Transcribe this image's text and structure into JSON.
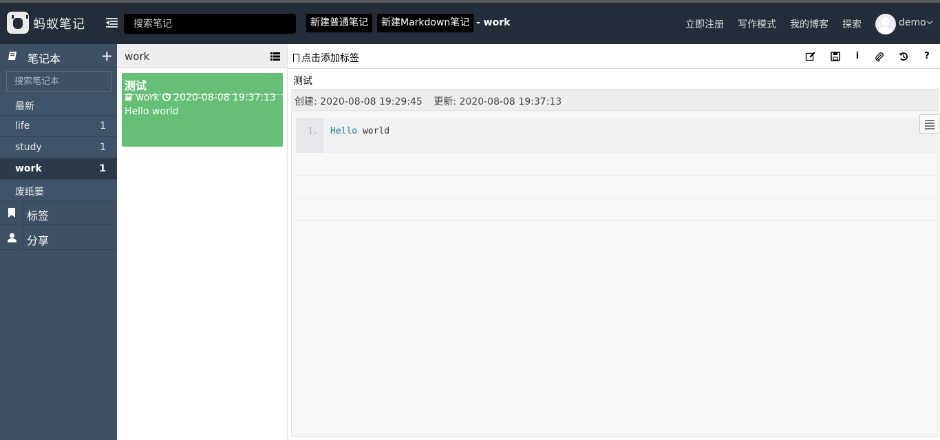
{
  "header": {
    "logo_text": "蚂蚁笔记",
    "search_placeholder": "搜索笔记",
    "new_note_label": "新建普通笔记",
    "new_markdown_label": "新建Markdown笔记",
    "current_notebook": "- work",
    "nav": [
      "立即注册",
      "写作模式",
      "我的博客",
      "探索"
    ],
    "username": "demo"
  },
  "sidebar": {
    "notebook_header": "笔记本",
    "add_symbol": "+",
    "notebook_search_placeholder": "搜索笔记本",
    "notebooks": [
      {
        "name": "最新",
        "count": ""
      },
      {
        "name": "life",
        "count": "1"
      },
      {
        "name": "study",
        "count": "1"
      },
      {
        "name": "work",
        "count": "1",
        "active": true
      },
      {
        "name": "废纸篓",
        "count": ""
      }
    ],
    "tags_label": "标签",
    "share_label": "分享"
  },
  "notelist": {
    "title": "work",
    "notes": [
      {
        "title": "测试",
        "notebook": "work",
        "time": "2020-08-08 19:37:13",
        "desc": "Hello world"
      }
    ]
  },
  "editor": {
    "add_tag_label": "点击添加标签",
    "toolbar_icons": [
      "edit-icon",
      "save-icon",
      "info-icon",
      "attachment-icon",
      "history-icon",
      "help-icon"
    ],
    "info_glyph": "i",
    "help_glyph": "?",
    "note_title": "测试",
    "created": "创建: 2020-08-08 19:29:45",
    "updated": "更新: 2020-08-08 19:37:13",
    "line_number": "1.",
    "code_keyword": "Hello",
    "code_rest": " world"
  },
  "colors": {
    "header_bg": "#232d3a",
    "sidebar_bg": "#3d5064",
    "note_card_bg": "#65bf76"
  }
}
